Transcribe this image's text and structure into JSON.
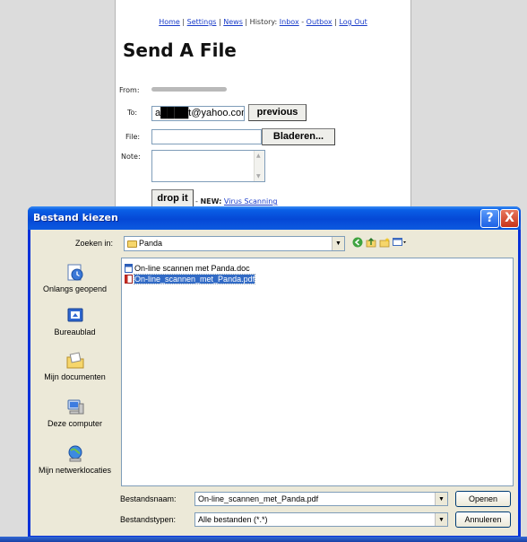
{
  "web": {
    "nav": {
      "home": "Home",
      "settings": "Settings",
      "news": "News",
      "history_label": "History:",
      "inbox": "Inbox",
      "outbox": "Outbox",
      "logout": "Log Out",
      "sep1": "|",
      "sep2": "|",
      "sep3": "|",
      "sep4": "-",
      "sep5": "|"
    },
    "title": "Send A File",
    "form": {
      "from_label": "From:",
      "to_label": "To:",
      "to_value": "a████t@yahoo.com",
      "previous_button": "previous",
      "file_label": "File:",
      "browse_button": "Bladeren...",
      "note_label": "Note:",
      "drop_button": "drop it",
      "new_prefix": "- ",
      "new_label": "NEW:",
      "new_link": "Virus Scanning"
    }
  },
  "dialog": {
    "title": "Bestand kiezen",
    "help_glyph": "?",
    "close_glyph": "X",
    "look_in_label": "Zoeken in:",
    "look_in_value": "Panda",
    "places": [
      {
        "label": "Onlangs geopend",
        "icon": "recent-documents-icon"
      },
      {
        "label": "Bureaublad",
        "icon": "desktop-icon"
      },
      {
        "label": "Mijn documenten",
        "icon": "my-documents-icon"
      },
      {
        "label": "Deze computer",
        "icon": "my-computer-icon"
      },
      {
        "label": "Mijn netwerklocaties",
        "icon": "network-places-icon"
      }
    ],
    "files": [
      {
        "name": "On-line scannen met Panda.doc",
        "icon": "word-doc-icon",
        "selected": false
      },
      {
        "name": "On-line_scannen_met_Panda.pdf",
        "icon": "pdf-icon",
        "selected": true
      }
    ],
    "filename_label": "Bestandsnaam:",
    "filename_value": "On-line_scannen_met_Panda.pdf",
    "filetype_label": "Bestandstypen:",
    "filetype_value": "Alle bestanden (*.*)",
    "open_button": "Openen",
    "cancel_button": "Annuleren"
  },
  "colors": {
    "titlebar": "#0548d6",
    "dialog_bg": "#ece9d8",
    "selection": "#316ac5",
    "link": "#1a3cc9"
  }
}
